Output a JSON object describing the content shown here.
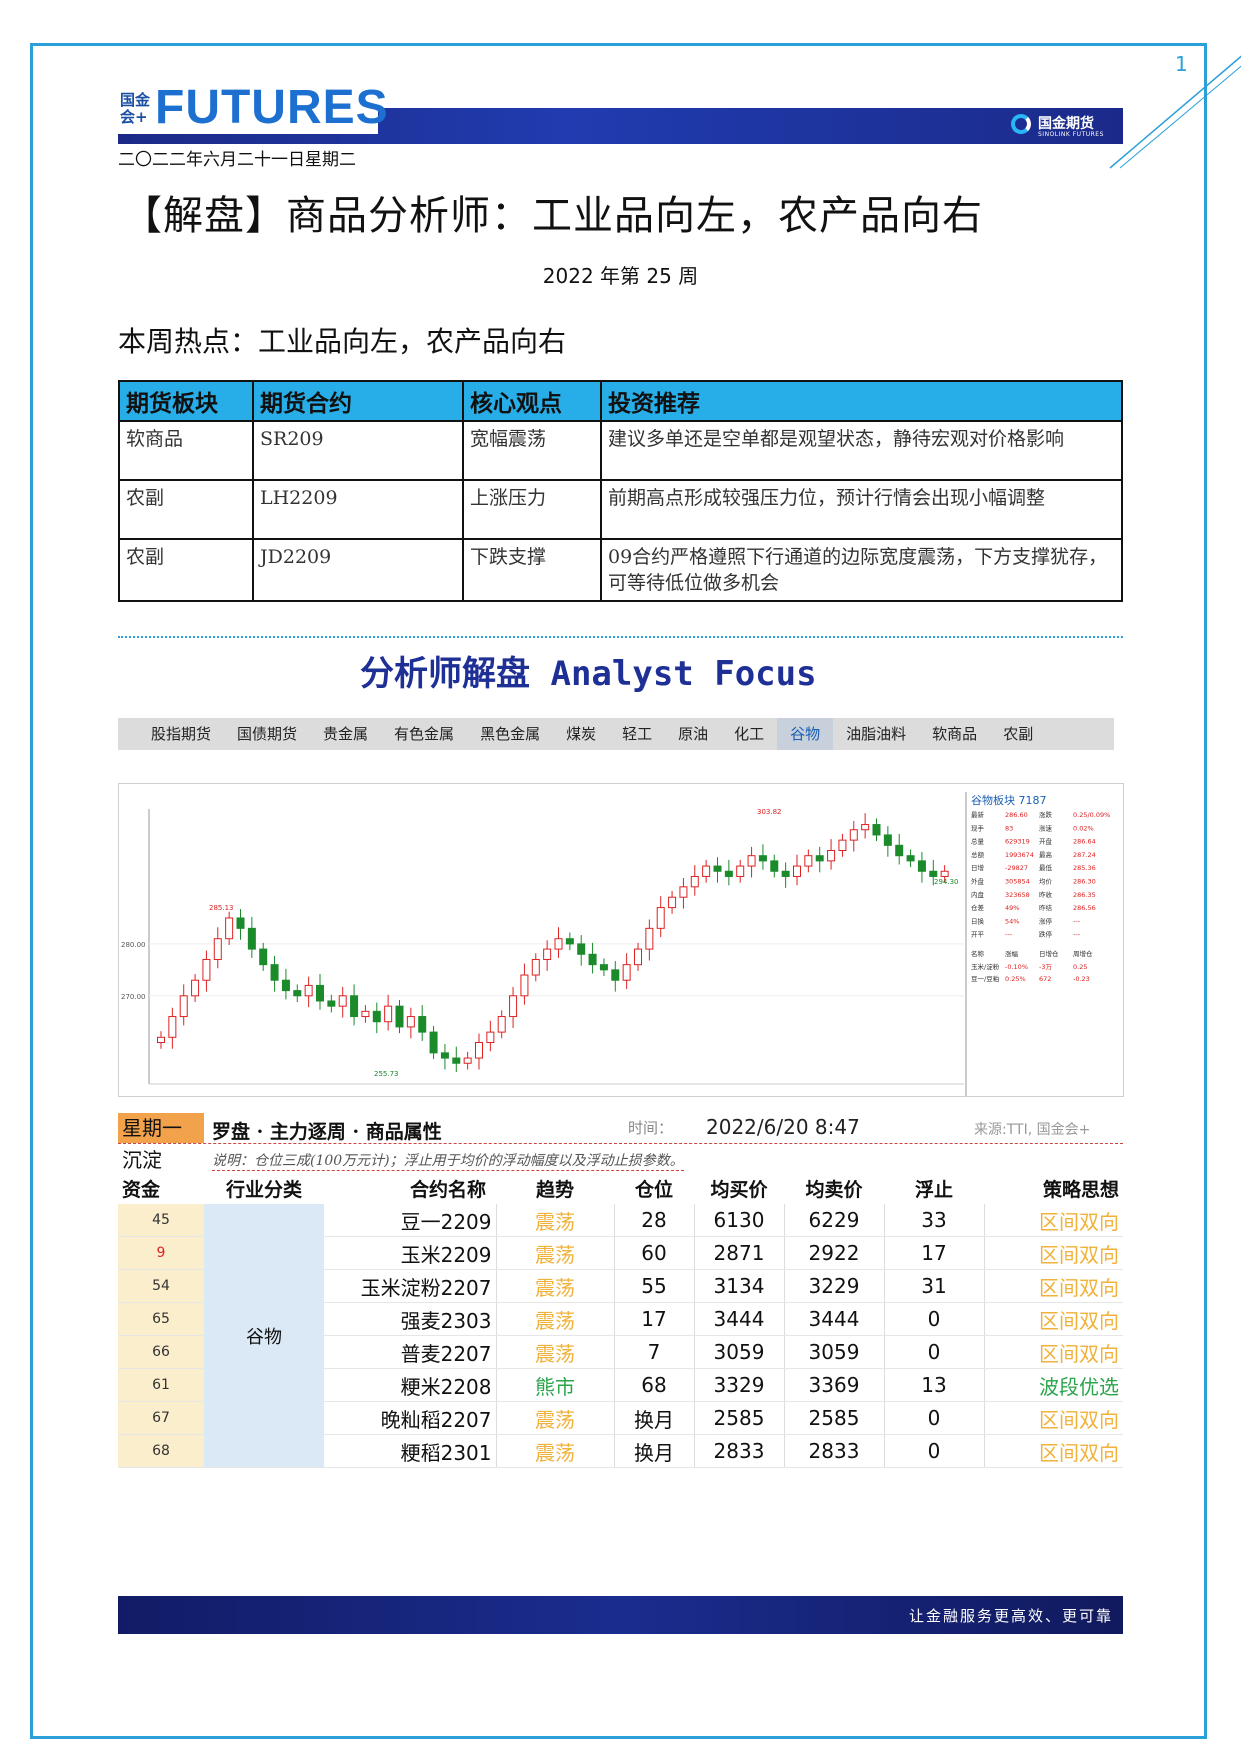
{
  "page_number": "1",
  "header": {
    "logo_cn": "国金会+",
    "logo_en": "FUTURES",
    "brand_cn": "国金期货",
    "brand_en": "SINOLINK FUTURES",
    "date": "二〇二二年六月二十一日星期二"
  },
  "title": "【解盘】商品分析师：工业品向左，农产品向右",
  "week": "2022 年第 25 周",
  "hot_topic": "本周热点：工业品向左，农产品向右",
  "summary_table": {
    "headers": [
      "期货板块",
      "期货合约",
      "核心观点",
      "投资推荐"
    ],
    "rows": [
      [
        "软商品",
        "SR209",
        "宽幅震荡",
        "建议多单还是空单都是观望状态，静待宏观对价格影响"
      ],
      [
        "农副",
        "LH2209",
        "上涨压力",
        "前期高点形成较强压力位，预计行情会出现小幅调整"
      ],
      [
        "农副",
        "JD2209",
        "下跌支撑",
        "09合约严格遵照下行通道的边际宽度震荡，下方支撑犹存，可等待低位做多机会"
      ]
    ]
  },
  "analyst_focus": {
    "cn": "分析师解盘",
    "en": "Analyst Focus"
  },
  "nav": {
    "tabs": [
      "股指期货",
      "国债期货",
      "贵金属",
      "有色金属",
      "黑色金属",
      "煤炭",
      "轻工",
      "原油",
      "化工",
      "谷物",
      "油脂油料",
      "软商品",
      "农副"
    ],
    "active_index": 9
  },
  "chart_data": {
    "type": "candlestick",
    "title": "谷物板块",
    "index_value": "7187",
    "annotations": {
      "high_left": "285.13",
      "low": "255.73",
      "high_right": "303.82",
      "last": "294.30"
    },
    "y_ticks": [
      "280.00",
      "270.00"
    ],
    "closes": [
      262,
      266,
      270,
      273,
      277,
      281,
      285,
      283,
      279,
      276,
      273,
      271,
      270,
      272,
      269,
      268,
      270,
      266,
      267,
      265,
      268,
      264,
      266,
      263,
      259,
      258,
      257,
      258,
      261,
      263,
      266,
      270,
      274,
      277,
      279,
      281,
      280,
      278,
      276,
      275,
      273,
      276,
      279,
      283,
      287,
      289,
      291,
      293,
      295,
      294,
      293,
      295,
      297,
      296,
      294,
      293,
      295,
      297,
      296,
      298,
      300,
      302,
      303,
      301,
      299,
      297,
      296,
      294,
      293,
      294
    ]
  },
  "side_panel": {
    "rows": [
      [
        "最新",
        "286.60",
        "涨跌",
        "0.25/0.09%"
      ],
      [
        "现手",
        "83",
        "涨速",
        "0.02%"
      ],
      [
        "总量",
        "629319",
        "开盘",
        "286.64"
      ],
      [
        "总额",
        "1993674",
        "最高",
        "287.24"
      ],
      [
        "日增",
        "-29827",
        "最低",
        "285.36"
      ],
      [
        "外盘",
        "305854",
        "均价",
        "286.30"
      ],
      [
        "内盘",
        "323658",
        "昨收",
        "286.35"
      ],
      [
        "仓差",
        "49%",
        "昨结",
        "286.56"
      ],
      [
        "日换",
        "54%",
        "涨停",
        "---"
      ],
      [
        "开平",
        "---",
        "跌停",
        "---"
      ]
    ],
    "sub_header": [
      "名称",
      "涨幅",
      "日增仓",
      "周增仓"
    ],
    "sub_rows": [
      [
        "玉米/淀粉",
        "-0.10%",
        "-3万",
        "0.25"
      ],
      [
        "豆一/豆粕",
        "0.25%",
        "672",
        "-0.23"
      ]
    ]
  },
  "data_table": {
    "day": "星期一",
    "title": "罗盘 · 主力逐周 · 商品属性",
    "time_label": "时间：",
    "time_value": "2022/6/20 8:47",
    "source": "来源:TTI, 国金会+",
    "sediment_label": "沉淀",
    "fund_label": "资金",
    "note": "说明：仓位三成(100万元计)；浮止用于均价的浮动幅度以及浮动止损参数。",
    "headers": [
      "行业分类",
      "合约名称",
      "趋势",
      "仓位",
      "均买价",
      "均卖价",
      "浮止",
      "策略思想"
    ],
    "category": "谷物",
    "rows": [
      {
        "fund": "45",
        "name": "豆一2209",
        "trend": "震荡",
        "pos": "28",
        "buy": "6130",
        "sell": "6229",
        "float": "33",
        "strategy": "区间双向"
      },
      {
        "fund": "9",
        "name": "玉米2209",
        "trend": "震荡",
        "pos": "60",
        "buy": "2871",
        "sell": "2922",
        "float": "17",
        "strategy": "区间双向"
      },
      {
        "fund": "54",
        "name": "玉米淀粉2207",
        "trend": "震荡",
        "pos": "55",
        "buy": "3134",
        "sell": "3229",
        "float": "31",
        "strategy": "区间双向"
      },
      {
        "fund": "65",
        "name": "强麦2303",
        "trend": "震荡",
        "pos": "17",
        "buy": "3444",
        "sell": "3444",
        "float": "0",
        "strategy": "区间双向"
      },
      {
        "fund": "66",
        "name": "普麦2207",
        "trend": "震荡",
        "pos": "7",
        "buy": "3059",
        "sell": "3059",
        "float": "0",
        "strategy": "区间双向"
      },
      {
        "fund": "61",
        "name": "粳米2208",
        "trend": "熊市",
        "pos": "68",
        "buy": "3329",
        "sell": "3369",
        "float": "13",
        "strategy": "波段优选"
      },
      {
        "fund": "67",
        "name": "晚籼稻2207",
        "trend": "震荡",
        "pos": "换月",
        "buy": "2585",
        "sell": "2585",
        "float": "0",
        "strategy": "区间双向"
      },
      {
        "fund": "68",
        "name": "粳稻2301",
        "trend": "震荡",
        "pos": "换月",
        "buy": "2833",
        "sell": "2833",
        "float": "0",
        "strategy": "区间双向"
      }
    ]
  },
  "footer": {
    "slogan": "让金融服务更高效、更可靠"
  },
  "colors": {
    "accent": "#2a9fd8",
    "header_blue": "#27aee8",
    "bull": "#d22",
    "bear": "#1a8a2a"
  }
}
